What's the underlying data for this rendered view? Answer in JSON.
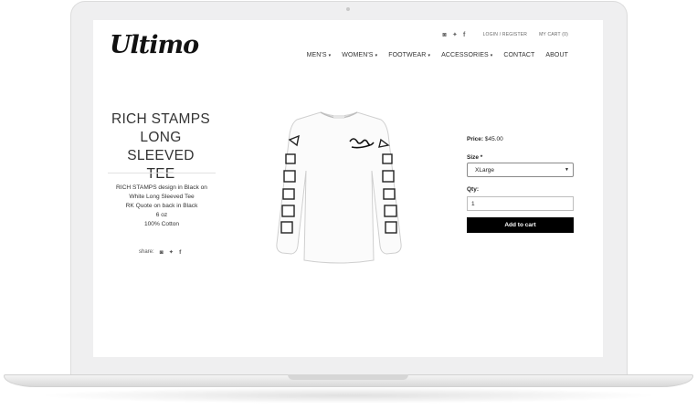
{
  "site": {
    "logo": "Ultimo",
    "top_links": [
      "LOGIN / REGISTER",
      "MY CART (0)"
    ],
    "social_icons": [
      "instagram-icon",
      "twitter-icon",
      "facebook-icon"
    ]
  },
  "nav": {
    "items": [
      {
        "label": "MEN'S",
        "dropdown": true
      },
      {
        "label": "WOMEN'S",
        "dropdown": true
      },
      {
        "label": "FOOTWEAR",
        "dropdown": true
      },
      {
        "label": "ACCESSORIES",
        "dropdown": true
      },
      {
        "label": "CONTACT",
        "dropdown": false
      },
      {
        "label": "ABOUT",
        "dropdown": false
      }
    ]
  },
  "product": {
    "title_lines": [
      "RICH STAMPS",
      "LONG SLEEVED",
      "TEE"
    ],
    "description_lines": [
      "RICH STAMPS design in Black on",
      "White Long Sleeved Tee",
      "RK Quote on back in Black",
      "6 oz",
      "100% Cotton"
    ],
    "share_label": "share:",
    "price_label": "Price:",
    "price_value": "$45.00",
    "size_label": "Size *",
    "size_selected": "XLarge",
    "qty_label": "Qty:",
    "qty_value": "1",
    "add_button": "Add to cart"
  }
}
